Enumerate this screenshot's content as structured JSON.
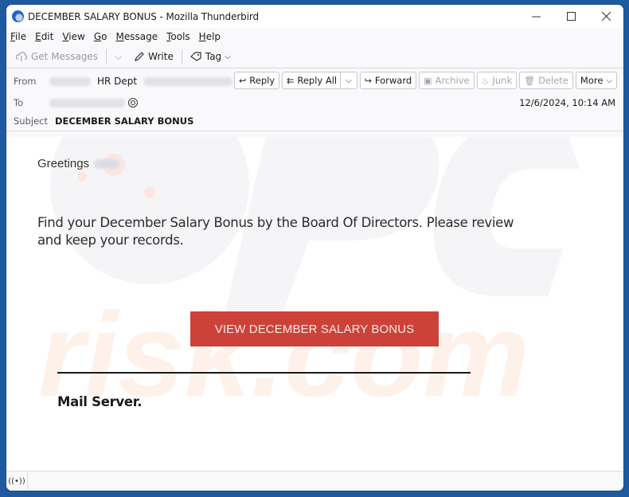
{
  "window": {
    "title": "DECEMBER SALARY BONUS - Mozilla Thunderbird",
    "controls": [
      "minimize",
      "maximize",
      "close"
    ]
  },
  "menubar": {
    "items": [
      {
        "label": "File",
        "accel": "F"
      },
      {
        "label": "Edit",
        "accel": "E"
      },
      {
        "label": "View",
        "accel": "V"
      },
      {
        "label": "Go",
        "accel": "G"
      },
      {
        "label": "Message",
        "accel": "M"
      },
      {
        "label": "Tools",
        "accel": "T"
      },
      {
        "label": "Help",
        "accel": "H"
      }
    ]
  },
  "toolbar": {
    "get_messages": "Get Messages",
    "write": "Write",
    "tag": "Tag"
  },
  "header": {
    "from_label": "From",
    "from_name": "HR Dept",
    "to_label": "To",
    "subject_label": "Subject",
    "subject": "DECEMBER SALARY BONUS",
    "date": "12/6/2024, 10:14 AM",
    "actions": {
      "reply": "Reply",
      "reply_all": "Reply All",
      "forward": "Forward",
      "archive": "Archive",
      "junk": "Junk",
      "delete": "Delete",
      "more": "More"
    }
  },
  "message": {
    "greeting": "Greetings",
    "body": "Find your December Salary Bonus by the Board Of Directors. Please review and keep your records.",
    "cta_button": "VIEW DECEMBER SALARY BONUS",
    "signature": "Mail Server.",
    "cta_color": "#cc4239"
  },
  "watermark": {
    "text": "risk.com"
  }
}
